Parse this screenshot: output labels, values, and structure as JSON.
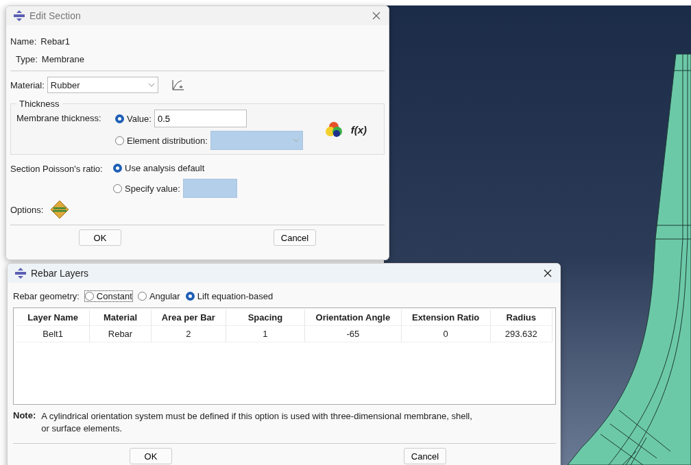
{
  "edit_section": {
    "title": "Edit Section",
    "name_label": "Name:",
    "name_value": "Rebar1",
    "type_label": "Type:",
    "type_value": "Membrane",
    "material_label": "Material:",
    "material_value": "Rubber",
    "thickness_group": "Thickness",
    "membrane_thickness_label": "Membrane thickness:",
    "thickness_options": [
      {
        "kind": "value",
        "label": "Value:",
        "selected": true
      },
      {
        "kind": "distribution",
        "label": "Element distribution:",
        "selected": false
      }
    ],
    "thickness_value": "0.5",
    "function_label": "f(x)",
    "poisson_label": "Section Poisson's ratio:",
    "poisson_options": [
      {
        "kind": "default",
        "label": "Use analysis default",
        "selected": true
      },
      {
        "kind": "specify",
        "label": "Specify value:",
        "selected": false
      }
    ],
    "options_label": "Options:",
    "buttons": [
      "OK",
      "Cancel"
    ]
  },
  "rebar_layers": {
    "title": "Rebar Layers",
    "geometry_label": "Rebar geometry:",
    "geometry_options": [
      {
        "label": "Constant",
        "selected": false,
        "focused": true
      },
      {
        "label": "Angular",
        "selected": false,
        "focused": false
      },
      {
        "label": "Lift equation-based",
        "selected": true,
        "focused": false
      }
    ],
    "table": {
      "columns": [
        "Layer Name",
        "Material",
        "Area per Bar",
        "Spacing",
        "Orientation Angle",
        "Extension Ratio",
        "Radius"
      ],
      "rows": [
        [
          "Belt1",
          "Rebar",
          "2",
          "1",
          "-65",
          "0",
          "293.632"
        ]
      ]
    },
    "note_label": "Note:",
    "note_text": "A cylindrical orientation system must be defined if this option is used with three-dimensional membrane, shell, or surface elements.",
    "buttons": [
      "OK",
      "Cancel"
    ]
  }
}
